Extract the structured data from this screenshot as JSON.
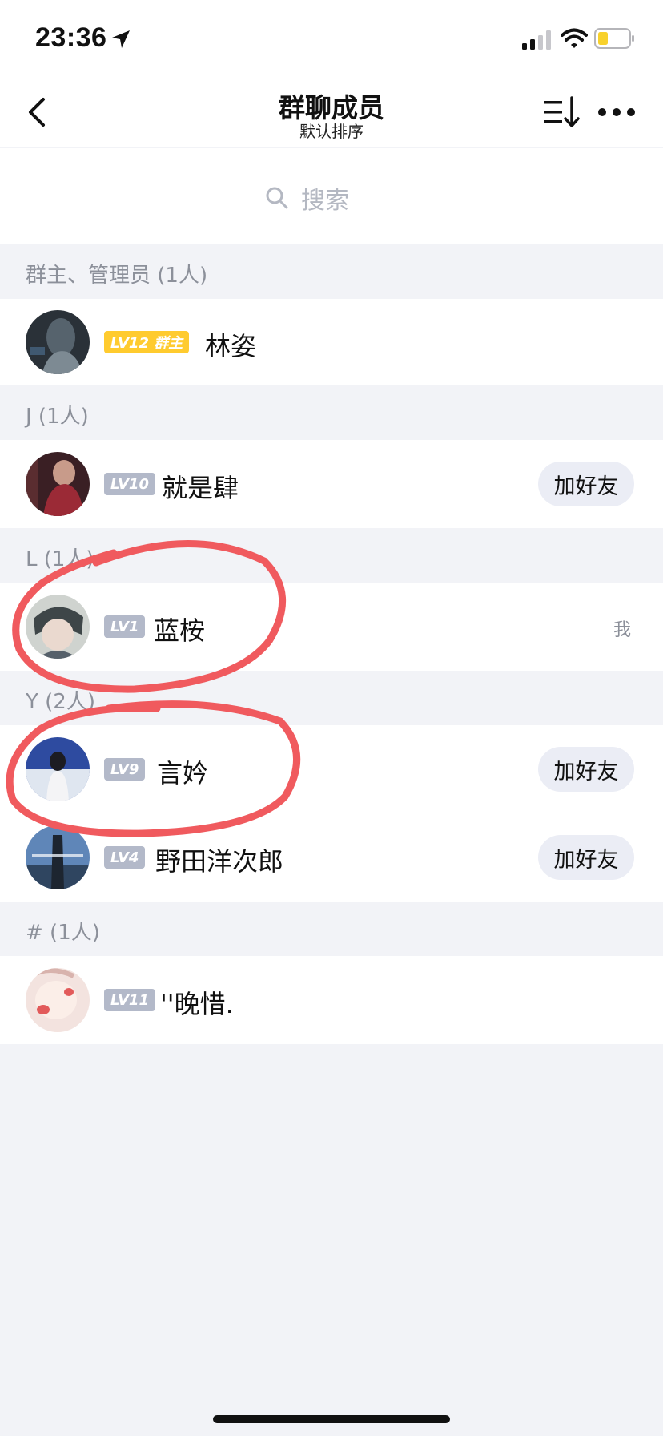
{
  "status_bar": {
    "time": "23:36"
  },
  "nav": {
    "title": "群聊成员",
    "subtitle": "默认排序"
  },
  "search": {
    "placeholder": "搜索"
  },
  "sections": [
    {
      "header": "群主、管理员 (1人)",
      "members": [
        {
          "name": "林姿",
          "level": "LV12 群主",
          "role": "owner",
          "action": ""
        }
      ]
    },
    {
      "header": "J (1人)",
      "members": [
        {
          "name": "就是肆",
          "level": "LV10",
          "action": "加好友"
        }
      ]
    },
    {
      "header": "L (1人)",
      "members": [
        {
          "name": "蓝桉",
          "level": "LV1",
          "action": "",
          "self_label": "我"
        }
      ]
    },
    {
      "header": "Y (2人)",
      "members": [
        {
          "name": "言妗",
          "level": "LV9",
          "action": "加好友"
        },
        {
          "name": "野田洋次郎",
          "level": "LV4",
          "action": "加好友"
        }
      ]
    },
    {
      "header": "# (1人)",
      "members": [
        {
          "name": "''晚惜.",
          "level": "LV11",
          "action": ""
        }
      ]
    }
  ],
  "colors": {
    "annotation": "#f05a5e",
    "owner_badge": "#ffcb2f",
    "level_badge": "#b3b9c9"
  }
}
